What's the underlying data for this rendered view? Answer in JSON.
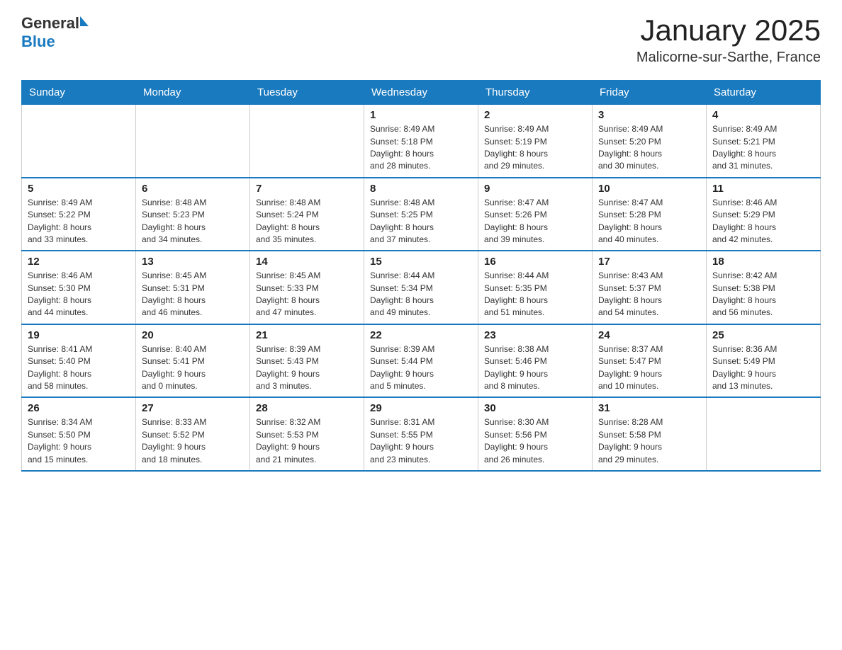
{
  "header": {
    "logo": {
      "general": "General",
      "blue": "Blue"
    },
    "title": "January 2025",
    "subtitle": "Malicorne-sur-Sarthe, France"
  },
  "weekdays": [
    "Sunday",
    "Monday",
    "Tuesday",
    "Wednesday",
    "Thursday",
    "Friday",
    "Saturday"
  ],
  "weeks": [
    [
      {
        "day": "",
        "info": ""
      },
      {
        "day": "",
        "info": ""
      },
      {
        "day": "",
        "info": ""
      },
      {
        "day": "1",
        "info": "Sunrise: 8:49 AM\nSunset: 5:18 PM\nDaylight: 8 hours\nand 28 minutes."
      },
      {
        "day": "2",
        "info": "Sunrise: 8:49 AM\nSunset: 5:19 PM\nDaylight: 8 hours\nand 29 minutes."
      },
      {
        "day": "3",
        "info": "Sunrise: 8:49 AM\nSunset: 5:20 PM\nDaylight: 8 hours\nand 30 minutes."
      },
      {
        "day": "4",
        "info": "Sunrise: 8:49 AM\nSunset: 5:21 PM\nDaylight: 8 hours\nand 31 minutes."
      }
    ],
    [
      {
        "day": "5",
        "info": "Sunrise: 8:49 AM\nSunset: 5:22 PM\nDaylight: 8 hours\nand 33 minutes."
      },
      {
        "day": "6",
        "info": "Sunrise: 8:48 AM\nSunset: 5:23 PM\nDaylight: 8 hours\nand 34 minutes."
      },
      {
        "day": "7",
        "info": "Sunrise: 8:48 AM\nSunset: 5:24 PM\nDaylight: 8 hours\nand 35 minutes."
      },
      {
        "day": "8",
        "info": "Sunrise: 8:48 AM\nSunset: 5:25 PM\nDaylight: 8 hours\nand 37 minutes."
      },
      {
        "day": "9",
        "info": "Sunrise: 8:47 AM\nSunset: 5:26 PM\nDaylight: 8 hours\nand 39 minutes."
      },
      {
        "day": "10",
        "info": "Sunrise: 8:47 AM\nSunset: 5:28 PM\nDaylight: 8 hours\nand 40 minutes."
      },
      {
        "day": "11",
        "info": "Sunrise: 8:46 AM\nSunset: 5:29 PM\nDaylight: 8 hours\nand 42 minutes."
      }
    ],
    [
      {
        "day": "12",
        "info": "Sunrise: 8:46 AM\nSunset: 5:30 PM\nDaylight: 8 hours\nand 44 minutes."
      },
      {
        "day": "13",
        "info": "Sunrise: 8:45 AM\nSunset: 5:31 PM\nDaylight: 8 hours\nand 46 minutes."
      },
      {
        "day": "14",
        "info": "Sunrise: 8:45 AM\nSunset: 5:33 PM\nDaylight: 8 hours\nand 47 minutes."
      },
      {
        "day": "15",
        "info": "Sunrise: 8:44 AM\nSunset: 5:34 PM\nDaylight: 8 hours\nand 49 minutes."
      },
      {
        "day": "16",
        "info": "Sunrise: 8:44 AM\nSunset: 5:35 PM\nDaylight: 8 hours\nand 51 minutes."
      },
      {
        "day": "17",
        "info": "Sunrise: 8:43 AM\nSunset: 5:37 PM\nDaylight: 8 hours\nand 54 minutes."
      },
      {
        "day": "18",
        "info": "Sunrise: 8:42 AM\nSunset: 5:38 PM\nDaylight: 8 hours\nand 56 minutes."
      }
    ],
    [
      {
        "day": "19",
        "info": "Sunrise: 8:41 AM\nSunset: 5:40 PM\nDaylight: 8 hours\nand 58 minutes."
      },
      {
        "day": "20",
        "info": "Sunrise: 8:40 AM\nSunset: 5:41 PM\nDaylight: 9 hours\nand 0 minutes."
      },
      {
        "day": "21",
        "info": "Sunrise: 8:39 AM\nSunset: 5:43 PM\nDaylight: 9 hours\nand 3 minutes."
      },
      {
        "day": "22",
        "info": "Sunrise: 8:39 AM\nSunset: 5:44 PM\nDaylight: 9 hours\nand 5 minutes."
      },
      {
        "day": "23",
        "info": "Sunrise: 8:38 AM\nSunset: 5:46 PM\nDaylight: 9 hours\nand 8 minutes."
      },
      {
        "day": "24",
        "info": "Sunrise: 8:37 AM\nSunset: 5:47 PM\nDaylight: 9 hours\nand 10 minutes."
      },
      {
        "day": "25",
        "info": "Sunrise: 8:36 AM\nSunset: 5:49 PM\nDaylight: 9 hours\nand 13 minutes."
      }
    ],
    [
      {
        "day": "26",
        "info": "Sunrise: 8:34 AM\nSunset: 5:50 PM\nDaylight: 9 hours\nand 15 minutes."
      },
      {
        "day": "27",
        "info": "Sunrise: 8:33 AM\nSunset: 5:52 PM\nDaylight: 9 hours\nand 18 minutes."
      },
      {
        "day": "28",
        "info": "Sunrise: 8:32 AM\nSunset: 5:53 PM\nDaylight: 9 hours\nand 21 minutes."
      },
      {
        "day": "29",
        "info": "Sunrise: 8:31 AM\nSunset: 5:55 PM\nDaylight: 9 hours\nand 23 minutes."
      },
      {
        "day": "30",
        "info": "Sunrise: 8:30 AM\nSunset: 5:56 PM\nDaylight: 9 hours\nand 26 minutes."
      },
      {
        "day": "31",
        "info": "Sunrise: 8:28 AM\nSunset: 5:58 PM\nDaylight: 9 hours\nand 29 minutes."
      },
      {
        "day": "",
        "info": ""
      }
    ]
  ]
}
